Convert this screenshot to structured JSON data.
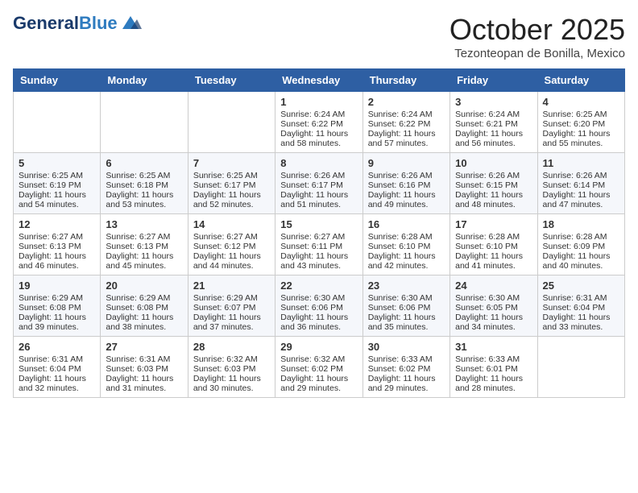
{
  "header": {
    "logo_general": "General",
    "logo_blue": "Blue",
    "month": "October 2025",
    "location": "Tezonteopan de Bonilla, Mexico"
  },
  "days_of_week": [
    "Sunday",
    "Monday",
    "Tuesday",
    "Wednesday",
    "Thursday",
    "Friday",
    "Saturday"
  ],
  "weeks": [
    [
      {
        "day": "",
        "info": ""
      },
      {
        "day": "",
        "info": ""
      },
      {
        "day": "",
        "info": ""
      },
      {
        "day": "1",
        "info": "Sunrise: 6:24 AM\nSunset: 6:22 PM\nDaylight: 11 hours and 58 minutes."
      },
      {
        "day": "2",
        "info": "Sunrise: 6:24 AM\nSunset: 6:22 PM\nDaylight: 11 hours and 57 minutes."
      },
      {
        "day": "3",
        "info": "Sunrise: 6:24 AM\nSunset: 6:21 PM\nDaylight: 11 hours and 56 minutes."
      },
      {
        "day": "4",
        "info": "Sunrise: 6:25 AM\nSunset: 6:20 PM\nDaylight: 11 hours and 55 minutes."
      }
    ],
    [
      {
        "day": "5",
        "info": "Sunrise: 6:25 AM\nSunset: 6:19 PM\nDaylight: 11 hours and 54 minutes."
      },
      {
        "day": "6",
        "info": "Sunrise: 6:25 AM\nSunset: 6:18 PM\nDaylight: 11 hours and 53 minutes."
      },
      {
        "day": "7",
        "info": "Sunrise: 6:25 AM\nSunset: 6:17 PM\nDaylight: 11 hours and 52 minutes."
      },
      {
        "day": "8",
        "info": "Sunrise: 6:26 AM\nSunset: 6:17 PM\nDaylight: 11 hours and 51 minutes."
      },
      {
        "day": "9",
        "info": "Sunrise: 6:26 AM\nSunset: 6:16 PM\nDaylight: 11 hours and 49 minutes."
      },
      {
        "day": "10",
        "info": "Sunrise: 6:26 AM\nSunset: 6:15 PM\nDaylight: 11 hours and 48 minutes."
      },
      {
        "day": "11",
        "info": "Sunrise: 6:26 AM\nSunset: 6:14 PM\nDaylight: 11 hours and 47 minutes."
      }
    ],
    [
      {
        "day": "12",
        "info": "Sunrise: 6:27 AM\nSunset: 6:13 PM\nDaylight: 11 hours and 46 minutes."
      },
      {
        "day": "13",
        "info": "Sunrise: 6:27 AM\nSunset: 6:13 PM\nDaylight: 11 hours and 45 minutes."
      },
      {
        "day": "14",
        "info": "Sunrise: 6:27 AM\nSunset: 6:12 PM\nDaylight: 11 hours and 44 minutes."
      },
      {
        "day": "15",
        "info": "Sunrise: 6:27 AM\nSunset: 6:11 PM\nDaylight: 11 hours and 43 minutes."
      },
      {
        "day": "16",
        "info": "Sunrise: 6:28 AM\nSunset: 6:10 PM\nDaylight: 11 hours and 42 minutes."
      },
      {
        "day": "17",
        "info": "Sunrise: 6:28 AM\nSunset: 6:10 PM\nDaylight: 11 hours and 41 minutes."
      },
      {
        "day": "18",
        "info": "Sunrise: 6:28 AM\nSunset: 6:09 PM\nDaylight: 11 hours and 40 minutes."
      }
    ],
    [
      {
        "day": "19",
        "info": "Sunrise: 6:29 AM\nSunset: 6:08 PM\nDaylight: 11 hours and 39 minutes."
      },
      {
        "day": "20",
        "info": "Sunrise: 6:29 AM\nSunset: 6:08 PM\nDaylight: 11 hours and 38 minutes."
      },
      {
        "day": "21",
        "info": "Sunrise: 6:29 AM\nSunset: 6:07 PM\nDaylight: 11 hours and 37 minutes."
      },
      {
        "day": "22",
        "info": "Sunrise: 6:30 AM\nSunset: 6:06 PM\nDaylight: 11 hours and 36 minutes."
      },
      {
        "day": "23",
        "info": "Sunrise: 6:30 AM\nSunset: 6:06 PM\nDaylight: 11 hours and 35 minutes."
      },
      {
        "day": "24",
        "info": "Sunrise: 6:30 AM\nSunset: 6:05 PM\nDaylight: 11 hours and 34 minutes."
      },
      {
        "day": "25",
        "info": "Sunrise: 6:31 AM\nSunset: 6:04 PM\nDaylight: 11 hours and 33 minutes."
      }
    ],
    [
      {
        "day": "26",
        "info": "Sunrise: 6:31 AM\nSunset: 6:04 PM\nDaylight: 11 hours and 32 minutes."
      },
      {
        "day": "27",
        "info": "Sunrise: 6:31 AM\nSunset: 6:03 PM\nDaylight: 11 hours and 31 minutes."
      },
      {
        "day": "28",
        "info": "Sunrise: 6:32 AM\nSunset: 6:03 PM\nDaylight: 11 hours and 30 minutes."
      },
      {
        "day": "29",
        "info": "Sunrise: 6:32 AM\nSunset: 6:02 PM\nDaylight: 11 hours and 29 minutes."
      },
      {
        "day": "30",
        "info": "Sunrise: 6:33 AM\nSunset: 6:02 PM\nDaylight: 11 hours and 29 minutes."
      },
      {
        "day": "31",
        "info": "Sunrise: 6:33 AM\nSunset: 6:01 PM\nDaylight: 11 hours and 28 minutes."
      },
      {
        "day": "",
        "info": ""
      }
    ]
  ]
}
